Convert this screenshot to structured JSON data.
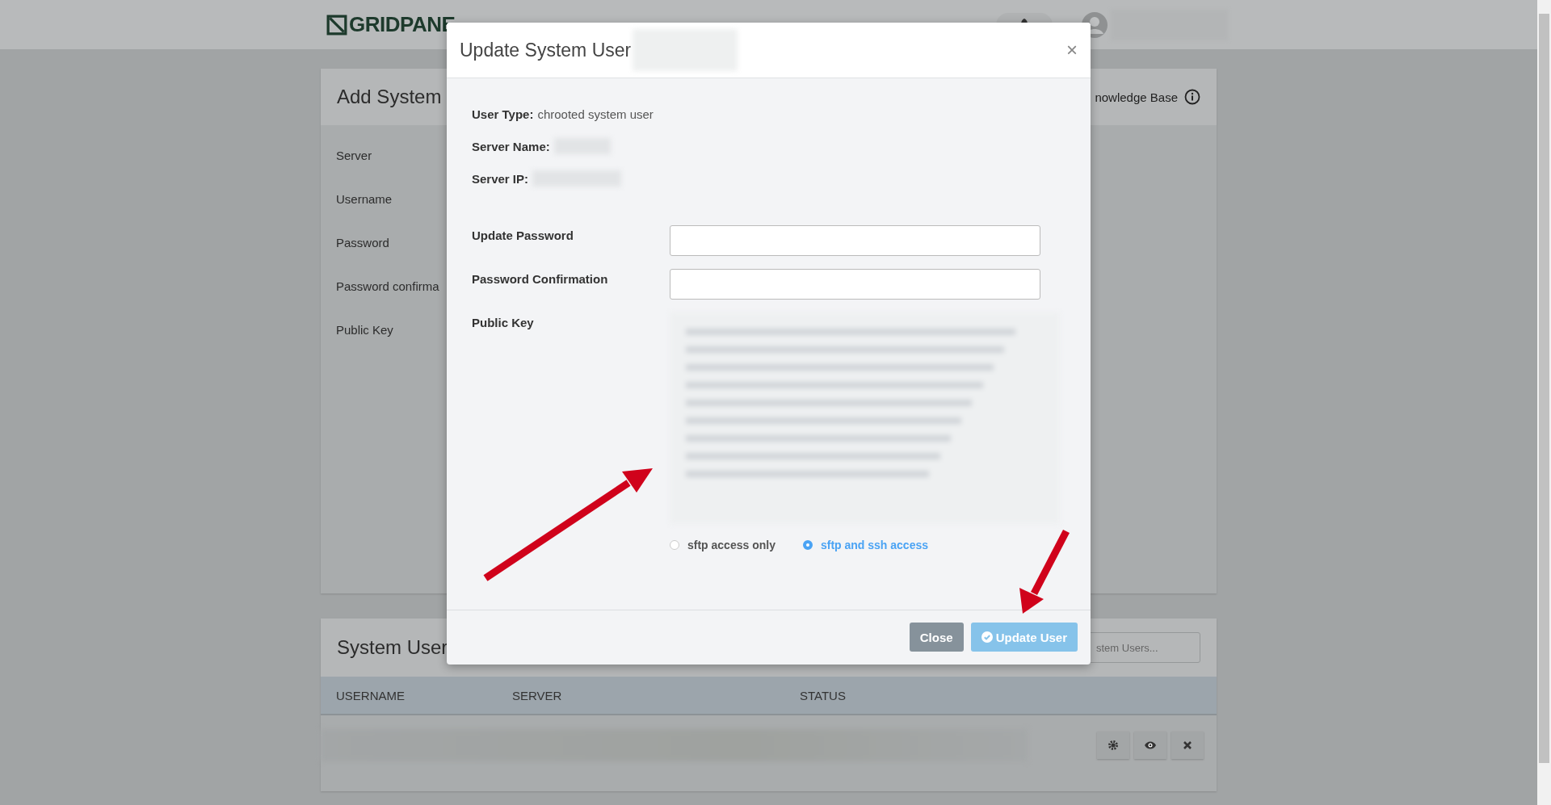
{
  "topbar": {
    "logo": "GRIDPANE"
  },
  "add_system": {
    "title": "Add System",
    "help_link": "nowledge Base",
    "fields": [
      "Server",
      "Username",
      "Password",
      "Password confirma",
      "Public Key"
    ]
  },
  "system_users": {
    "title": "System User",
    "search": {
      "placeholder": "stem Users..."
    },
    "columns": [
      "USERNAME",
      "SERVER",
      "STATUS"
    ]
  },
  "modal": {
    "title": "Update System User",
    "close_glyph": "×",
    "info": [
      {
        "label": "User Type:",
        "value": "chrooted system user"
      },
      {
        "label": "Server Name:"
      },
      {
        "label": "Server IP:"
      }
    ],
    "fields": [
      {
        "label": "Update Password",
        "kind": "input"
      },
      {
        "label": "Password Confirmation",
        "kind": "input"
      },
      {
        "label": "Public Key",
        "kind": "textarea"
      }
    ],
    "access": [
      {
        "label": "sftp access only",
        "selected": false
      },
      {
        "label": "sftp and ssh access",
        "selected": true
      }
    ],
    "buttons": [
      {
        "label": "Close",
        "kind": "secondary"
      },
      {
        "label": "Update User",
        "kind": "primary"
      }
    ]
  }
}
